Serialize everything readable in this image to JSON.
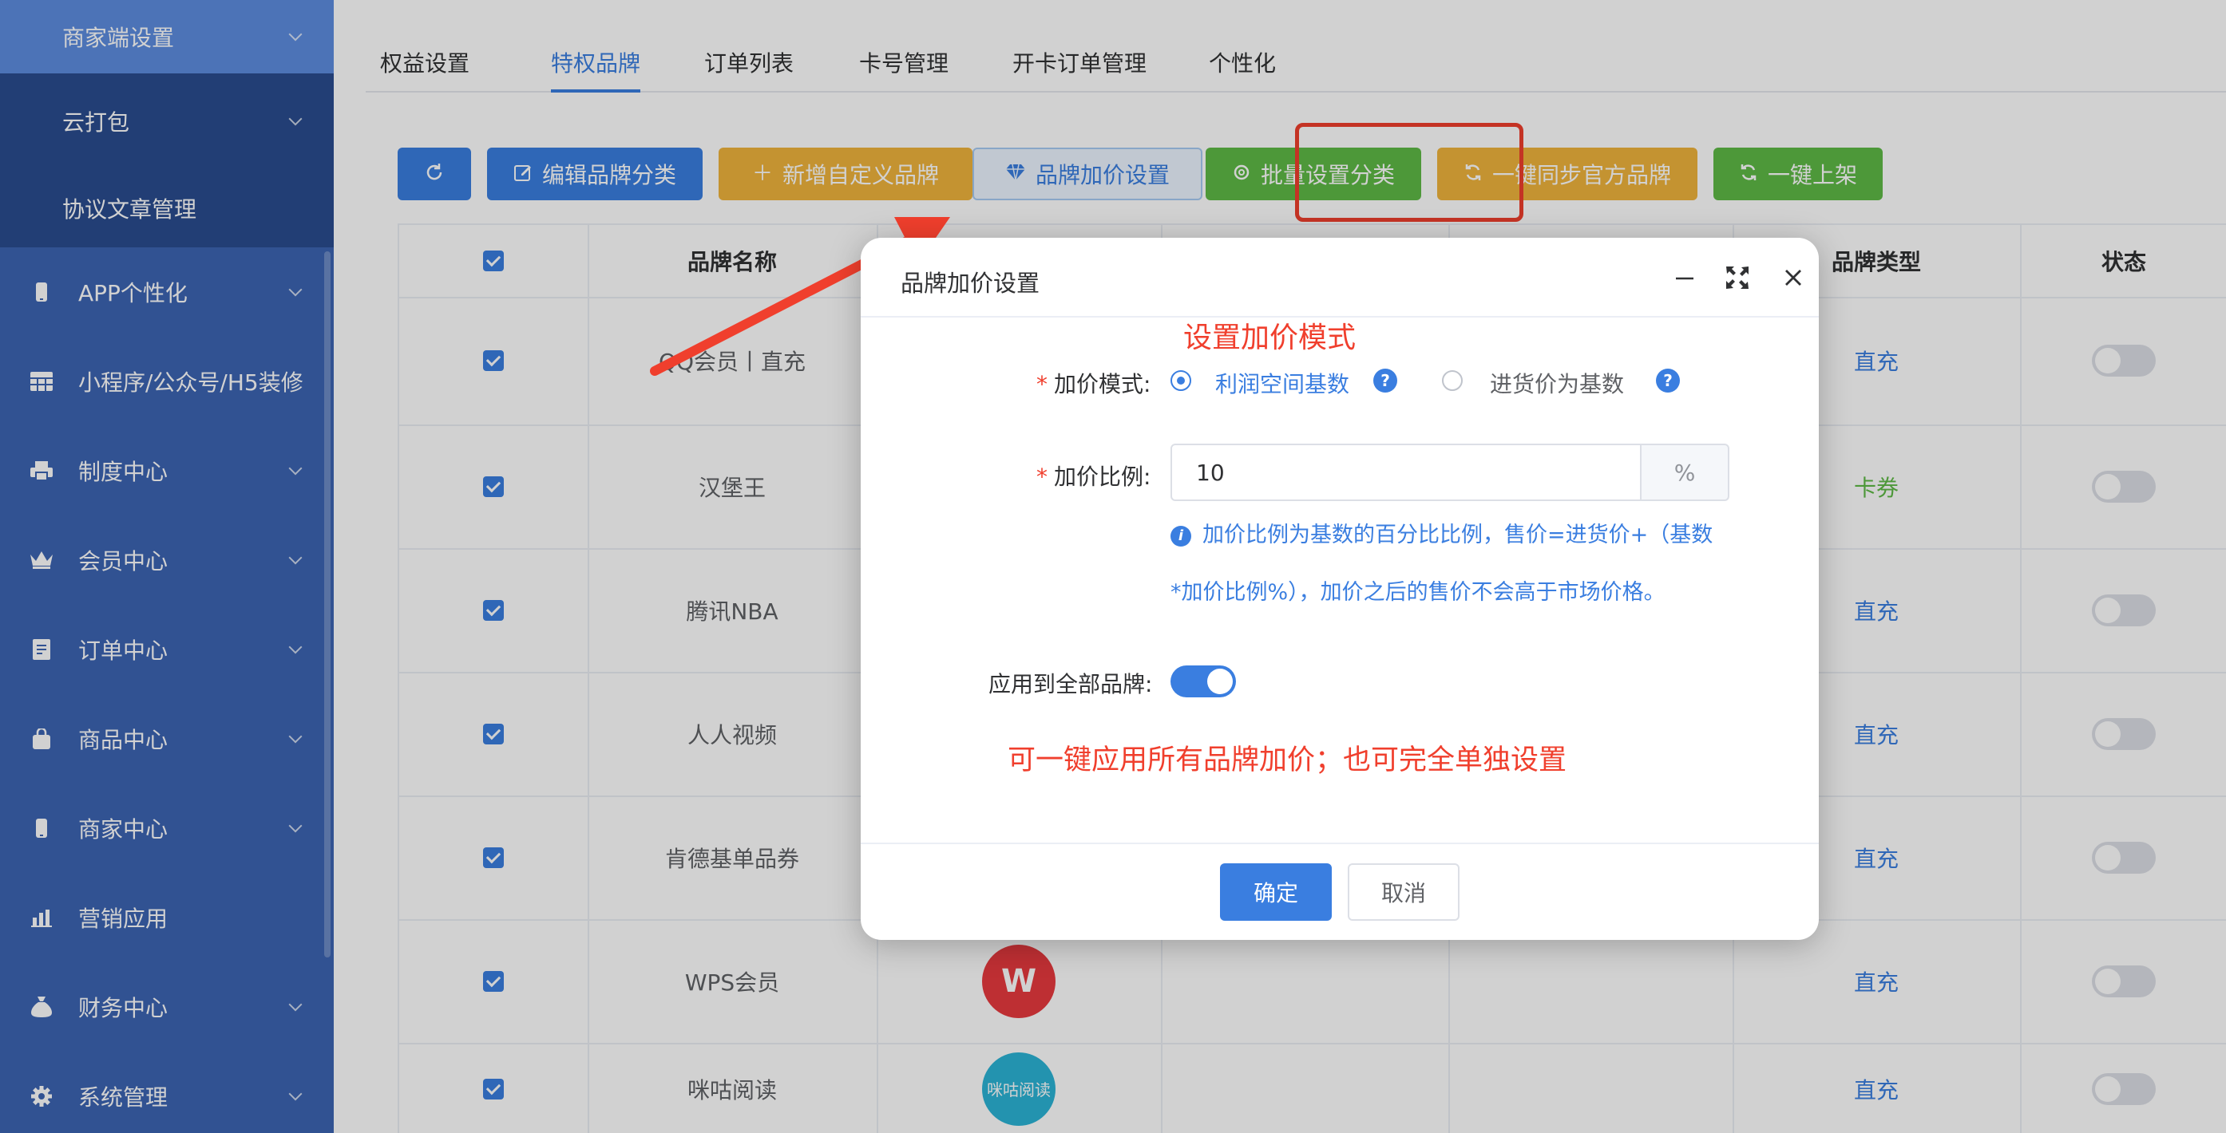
{
  "sidebar": {
    "items": [
      {
        "label": "商家端设置",
        "icon": "none",
        "chevron": true
      },
      {
        "label": "云打包",
        "icon": "none",
        "chevron": true
      },
      {
        "label": "协议文章管理",
        "icon": "none",
        "chevron": false
      },
      {
        "label": "APP个性化",
        "icon": "phone-icon",
        "chevron": true
      },
      {
        "label": "小程序/公众号/H5装修",
        "icon": "grid-icon",
        "chevron": false
      },
      {
        "label": "制度中心",
        "icon": "printer-icon",
        "chevron": true
      },
      {
        "label": "会员中心",
        "icon": "crown-icon",
        "chevron": true
      },
      {
        "label": "订单中心",
        "icon": "document-icon",
        "chevron": true
      },
      {
        "label": "商品中心",
        "icon": "bag-icon",
        "chevron": true
      },
      {
        "label": "商家中心",
        "icon": "phone-icon",
        "chevron": true
      },
      {
        "label": "营销应用",
        "icon": "chart-icon",
        "chevron": false
      },
      {
        "label": "财务中心",
        "icon": "money-bag-icon",
        "chevron": true
      },
      {
        "label": "系统管理",
        "icon": "gear-icon",
        "chevron": true
      }
    ]
  },
  "tabs": [
    "权益设置",
    "特权品牌",
    "订单列表",
    "卡号管理",
    "开卡订单管理",
    "个性化"
  ],
  "active_tab": "特权品牌",
  "toolbar": {
    "refresh_icon": "refresh-icon",
    "buttons": [
      {
        "label": "编辑品牌分类",
        "icon": "edit-icon"
      },
      {
        "label": "新增自定义品牌",
        "icon": "plus-icon"
      },
      {
        "label": "品牌加价设置",
        "icon": "diamond-icon"
      },
      {
        "label": "批量设置分类",
        "icon": "gear-icon"
      },
      {
        "label": "一键同步官方品牌",
        "icon": "sync-icon"
      },
      {
        "label": "一键上架",
        "icon": "sync-icon"
      }
    ]
  },
  "table": {
    "headers": {
      "name": "品牌名称",
      "type": "品牌类型",
      "status": "状态"
    },
    "rows": [
      {
        "name": "QQ会员丨直充",
        "type": "直充",
        "type_color": "#3a7ee0",
        "status": false
      },
      {
        "name": "汉堡王",
        "type": "卡券",
        "type_color": "#5fba46",
        "status": false
      },
      {
        "name": "腾讯NBA",
        "type": "直充",
        "type_color": "#3a7ee0",
        "status": false
      },
      {
        "name": "人人视频",
        "type": "直充",
        "type_color": "#3a7ee0",
        "status": false
      },
      {
        "name": "肯德基单品券",
        "type": "直充",
        "type_color": "#3a7ee0",
        "status": false
      },
      {
        "name": "WPS会员",
        "type": "直充",
        "type_color": "#3a7ee0",
        "status": false,
        "logo_text": "W"
      },
      {
        "name": "咪咕阅读",
        "type": "直充",
        "type_color": "#3a7ee0",
        "status": false,
        "logo_text": "咪咕阅读"
      }
    ]
  },
  "dialog": {
    "title": "品牌加价设置",
    "annotation_top": "设置加价模式",
    "mode_label": "加价模式:",
    "mode_options": [
      "利润空间基数",
      "进货价为基数"
    ],
    "mode_selected": "利润空间基数",
    "ratio_label": "加价比例:",
    "ratio_value": "10",
    "ratio_unit": "%",
    "tip_line1": "加价比例为基数的百分比比例，售价=进货价+（基数",
    "tip_line2": "*加价比例%），加价之后的售价不会高于市场价格。",
    "apply_all_label": "应用到全部品牌:",
    "apply_all": true,
    "annotation_bottom": "可一键应用所有品牌加价；也可完全单独设置",
    "confirm_label": "确定",
    "cancel_label": "取消"
  },
  "colors": {
    "primary": "#3a7ee0",
    "sidebar": "#3c64b3",
    "annotation": "#f03f2d",
    "warning": "#f0b43c",
    "success": "#5fba46"
  }
}
